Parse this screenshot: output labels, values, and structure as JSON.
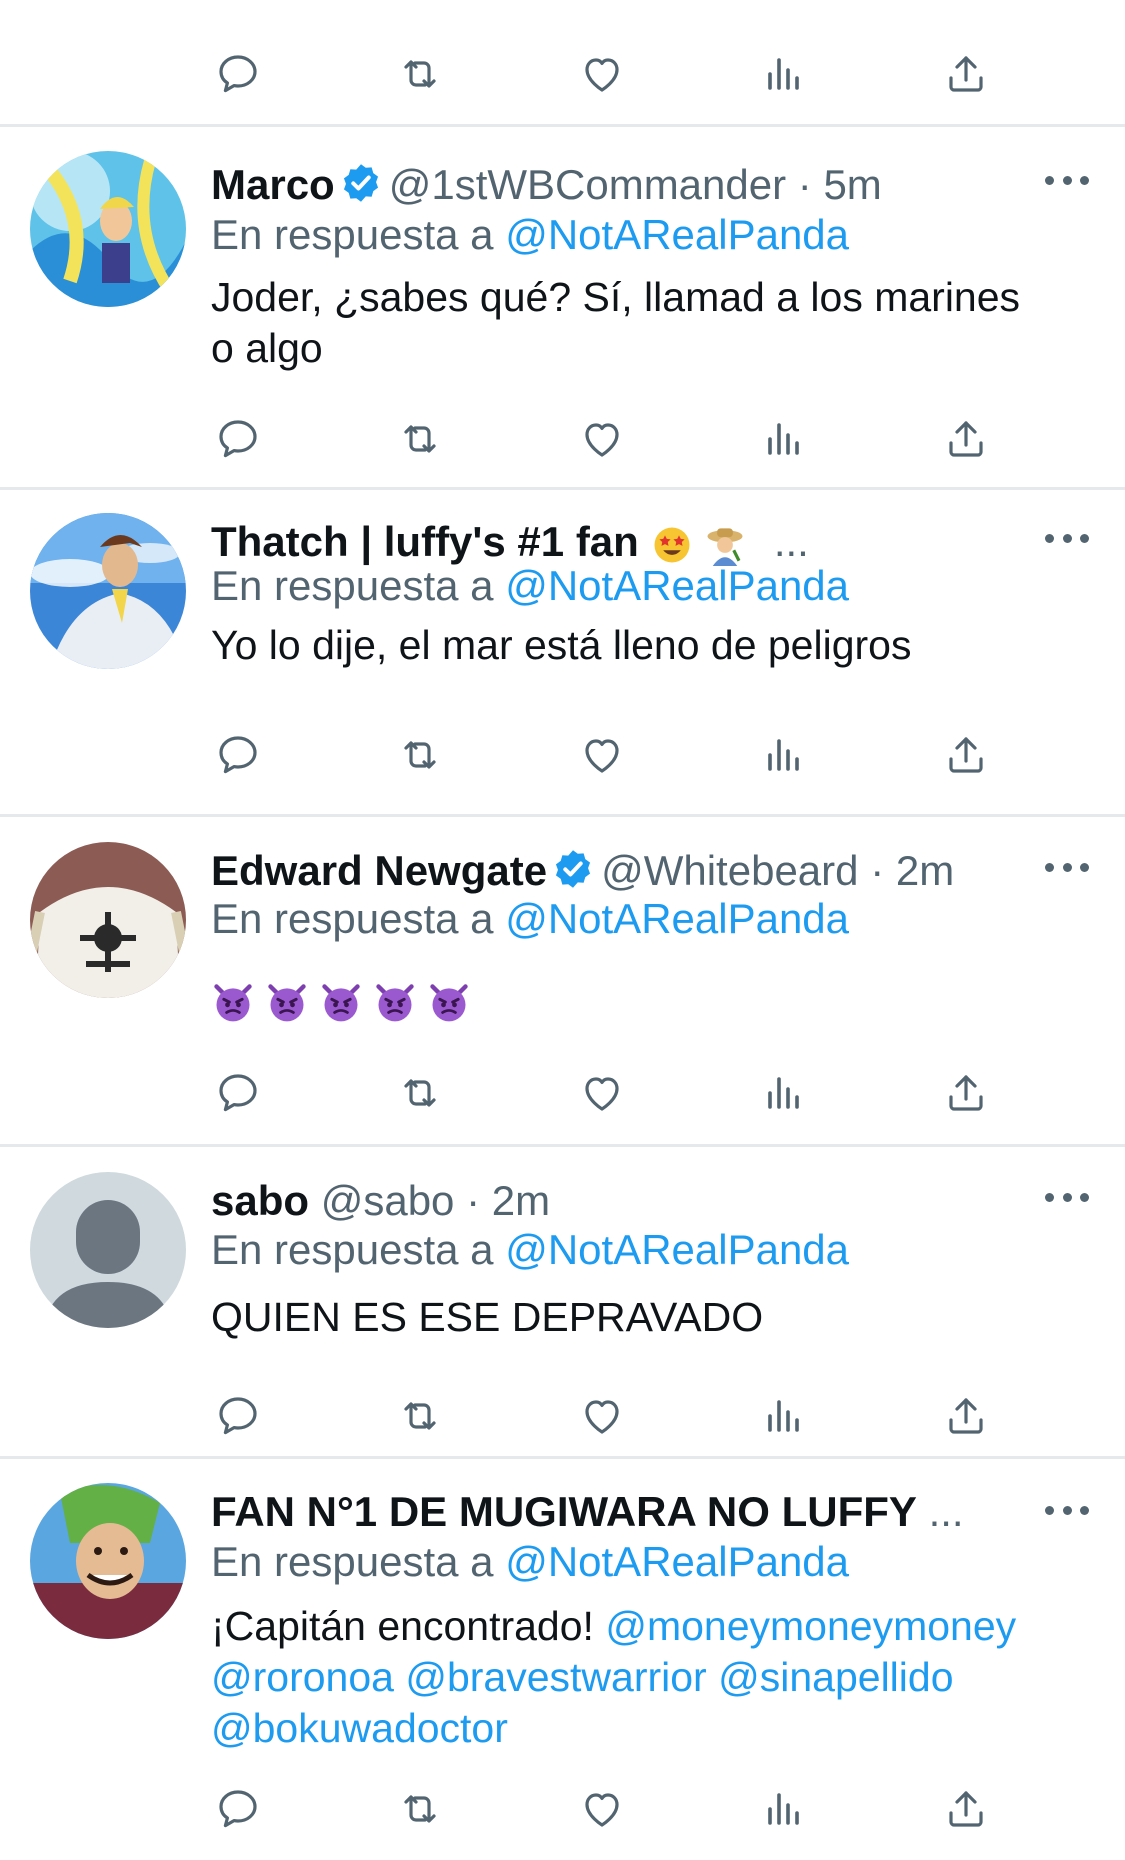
{
  "tweets": [
    {
      "name": "Marco",
      "verified": true,
      "handle": "@1stWBCommander",
      "dot": "·",
      "time": "5m",
      "reply_prefix": "En respuesta a",
      "reply_to": "@NotARealPanda",
      "text_line1": "Joder, ¿sabes qué? Sí, llamad a los marines",
      "text_line2": "o algo"
    },
    {
      "name": "Thatch | luffy's #1 fan",
      "ellipsis": "...",
      "reply_prefix": "En respuesta a",
      "reply_to": "@NotARealPanda",
      "text_line1": "Yo lo dije, el mar está lleno de peligros"
    },
    {
      "name": "Edward Newgate",
      "verified": true,
      "handle": "@Whitebeard",
      "dot": "·",
      "time": "2m",
      "reply_prefix": "En respuesta a",
      "reply_to": "@NotARealPanda",
      "emoji": "devil-face-emoji x5"
    },
    {
      "name": "sabo",
      "handle": "@sabo",
      "dot": "·",
      "time": "2m",
      "reply_prefix": "En respuesta a",
      "reply_to": "@NotARealPanda",
      "text_line1": "QUIEN ES ESE DEPRAVADO"
    },
    {
      "name": "FAN N°1 DE MUGIWARA NO LUFFY",
      "ellipsis": "...",
      "reply_prefix": "En respuesta a",
      "reply_to": "@NotARealPanda",
      "text_prefix": "¡Capitán encontrado!",
      "mentions": [
        "@moneymoneymoney",
        "@roronoa",
        "@bravestwarrior",
        "@sinapellido",
        "@bokuwadoctor"
      ]
    }
  ],
  "icons": [
    "reply-icon",
    "retweet-icon",
    "like-icon",
    "views-icon",
    "share-icon",
    "more-icon",
    "verified-icon"
  ],
  "colors": {
    "accent": "#1d9bf0",
    "muted": "#536471",
    "text": "#0f1419",
    "divider": "#e6e9ec"
  }
}
